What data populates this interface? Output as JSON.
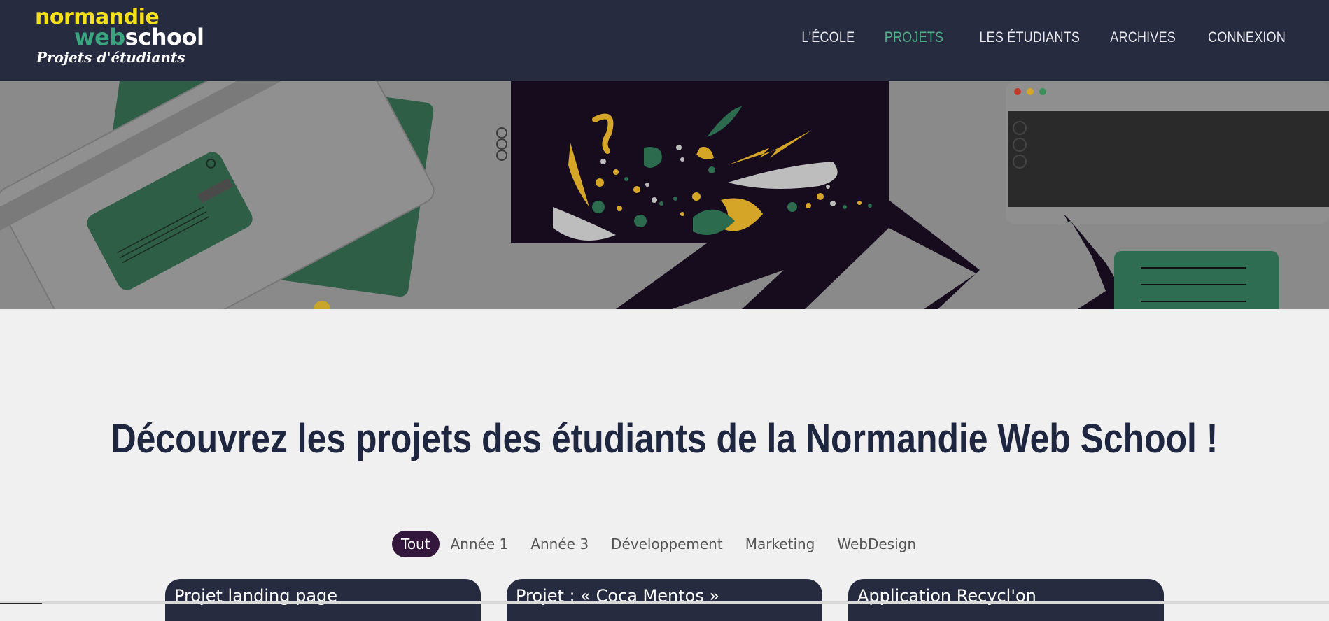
{
  "logo": {
    "line1": "normandie",
    "line2_web": "web",
    "line2_school": "school",
    "tagline": "Projets d'étudiants"
  },
  "nav": {
    "items": [
      {
        "label": "L'ÉCOLE",
        "active": false
      },
      {
        "label": "PROJETS",
        "active": true
      },
      {
        "label": "LES ÉTUDIANTS",
        "active": false
      },
      {
        "label": "ARCHIVES",
        "active": false
      },
      {
        "label": "CONNEXION",
        "active": false
      }
    ]
  },
  "page": {
    "title": "Découvrez les projets des étudiants de la Normandie Web School !"
  },
  "filters": [
    {
      "label": "Tout",
      "active": true
    },
    {
      "label": "Année 1",
      "active": false
    },
    {
      "label": "Année 3",
      "active": false
    },
    {
      "label": "Développement",
      "active": false
    },
    {
      "label": "Marketing",
      "active": false
    },
    {
      "label": "WebDesign",
      "active": false
    }
  ],
  "cards": [
    {
      "title": "Projet landing page"
    },
    {
      "title": "Projet : « Coca Mentos »"
    },
    {
      "title": "Application Recycl'on"
    }
  ],
  "colors": {
    "header_bg": "#262b40",
    "accent_green": "#4fae86",
    "logo_yellow": "#f4e11b",
    "active_filter": "#33173c",
    "title": "#1f2640"
  }
}
